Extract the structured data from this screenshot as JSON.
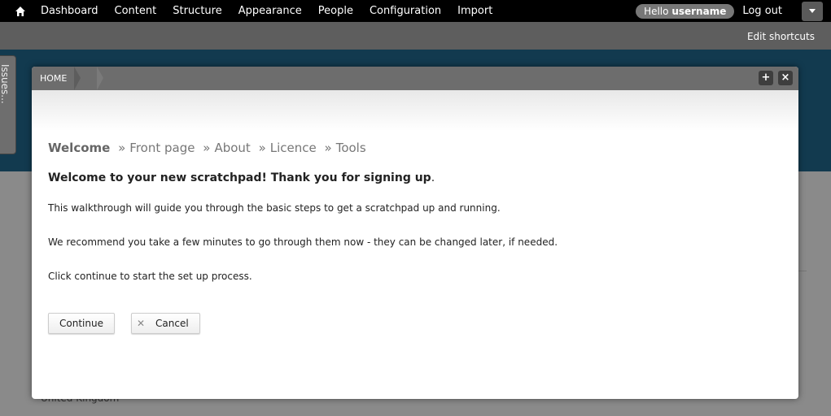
{
  "toolbar": {
    "home_icon": "home-icon",
    "menu": [
      "Dashboard",
      "Content",
      "Structure",
      "Appearance",
      "People",
      "Configuration",
      "Import"
    ],
    "hello_prefix": "Hello",
    "username": "username",
    "logout": "Log out"
  },
  "shortcuts": {
    "edit": "Edit shortcuts"
  },
  "side_tab": {
    "label": "Issues..."
  },
  "background": {
    "text": "United Kingdom"
  },
  "dialog": {
    "breadcrumb": "HOME",
    "plus_icon": "plus-icon",
    "close_icon": "close-icon",
    "steps": [
      "Welcome",
      "Front page",
      "About",
      "Licence",
      "Tools"
    ],
    "step_separator": "»",
    "heading": "Welcome to your new scratchpad! Thank you for signing up",
    "heading_end": ".",
    "paragraphs": [
      "This walkthrough will guide you through the basic steps to get a scratchpad up and running.",
      "We recommend you take a few minutes to go through them now - they can be changed later, if needed.",
      "Click continue to start the set up process."
    ],
    "continue_label": "Continue",
    "cancel_label": "Cancel"
  },
  "colors": {
    "toolbar_bg": "#000000",
    "shortcut_bar_bg": "#5e5e5e",
    "site_header_bg": "#123a4f"
  }
}
